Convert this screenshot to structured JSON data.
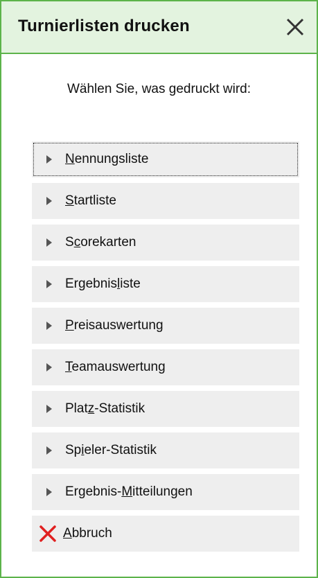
{
  "dialog": {
    "title": "Turnierlisten drucken",
    "close_icon": "close-icon",
    "prompt": "Wählen Sie, was gedruckt wird:"
  },
  "menu": {
    "items": [
      {
        "pre": "",
        "mn": "N",
        "post": "ennungsliste",
        "name": "menu-item-nennungsliste",
        "icon": "arrow-right-icon",
        "focused": true
      },
      {
        "pre": "",
        "mn": "S",
        "post": "tartliste",
        "name": "menu-item-startliste",
        "icon": "arrow-right-icon"
      },
      {
        "pre": "S",
        "mn": "c",
        "post": "orekarten",
        "name": "menu-item-scorekarten",
        "icon": "arrow-right-icon"
      },
      {
        "pre": "Ergebnis",
        "mn": "l",
        "post": "iste",
        "name": "menu-item-ergebnisliste",
        "icon": "arrow-right-icon"
      },
      {
        "pre": "",
        "mn": "P",
        "post": "reisauswertung",
        "name": "menu-item-preisauswertung",
        "icon": "arrow-right-icon"
      },
      {
        "pre": "",
        "mn": "T",
        "post": "eamauswertung",
        "name": "menu-item-teamauswertung",
        "icon": "arrow-right-icon"
      },
      {
        "pre": "Plat",
        "mn": "z",
        "post": "-Statistik",
        "name": "menu-item-platz-statistik",
        "icon": "arrow-right-icon"
      },
      {
        "pre": "Sp",
        "mn": "i",
        "post": "eler-Statistik",
        "name": "menu-item-spieler-statistik",
        "icon": "arrow-right-icon"
      },
      {
        "pre": "Ergebnis-",
        "mn": "M",
        "post": "itteilungen",
        "name": "menu-item-ergebnis-mitteilungen",
        "icon": "arrow-right-icon"
      }
    ],
    "cancel": {
      "pre": "",
      "mn": "A",
      "post": "bbruch",
      "icon": "cancel-x-icon"
    }
  },
  "colors": {
    "accent_border": "#5cb34a",
    "titlebar_bg": "#e3f3df",
    "item_bg": "#eeeeee",
    "cancel_icon": "#e02020"
  }
}
